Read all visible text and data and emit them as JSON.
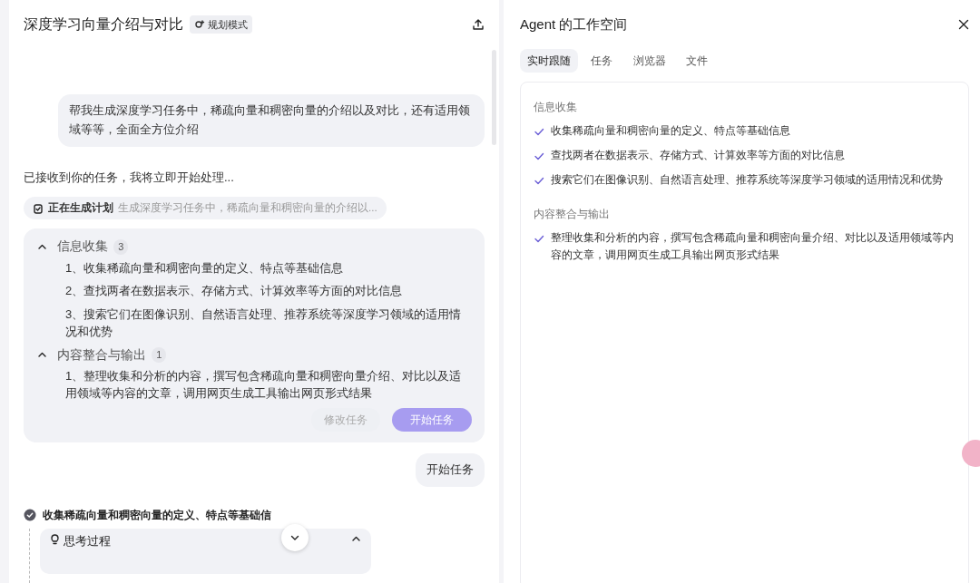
{
  "chat": {
    "title": "深度学习向量介绍与对比",
    "mode_badge": "规划模式",
    "user_message": "帮我生成深度学习任务中，稀疏向量和稠密向量的介绍以及对比，还有适用领域等等，全面全方位介绍",
    "assistant_message": "已接收到你的任务，我将立即开始处理...",
    "plan_status": {
      "label": "正在生成计划",
      "summary": "生成深度学习任务中，稀疏向量和稠密向量的介绍以..."
    },
    "plan_groups": [
      {
        "title": "信息收集",
        "count": "3",
        "expanded": true,
        "items": [
          "1、收集稀疏向量和稠密向量的定义、特点等基础信息",
          "2、查找两者在数据表示、存储方式、计算效率等方面的对比信息",
          "3、搜索它们在图像识别、自然语言处理、推荐系统等深度学习领域的适用情况和优势"
        ]
      },
      {
        "title": "内容整合与输出",
        "count": "1",
        "expanded": true,
        "items": [
          "1、整理收集和分析的内容，撰写包含稀疏向量和稠密向量介绍、对比以及适用领域等内容的文章，调用网页生成工具输出网页形式结果"
        ]
      }
    ],
    "plan_buttons": [
      {
        "label": "修改任务",
        "kind": "secondary"
      },
      {
        "label": "开始任务",
        "kind": "primary"
      }
    ],
    "user_reply": "开始任务",
    "step": {
      "title": "收集稀疏向量和稠密向量的定义、特点等基础信",
      "done": true
    },
    "thinking": {
      "label": "思考过程",
      "expanded": true
    }
  },
  "workspace": {
    "title": "Agent 的工作空间",
    "tabs": [
      {
        "label": "实时跟随",
        "selected": true
      },
      {
        "label": "任务",
        "selected": false
      },
      {
        "label": "浏览器",
        "selected": false
      },
      {
        "label": "文件",
        "selected": false
      }
    ],
    "sections": [
      {
        "title": "信息收集",
        "items": [
          {
            "text": "收集稀疏向量和稠密向量的定义、特点等基础信息",
            "checked": true
          },
          {
            "text": "查找两者在数据表示、存储方式、计算效率等方面的对比信息",
            "checked": true
          },
          {
            "text": "搜索它们在图像识别、自然语言处理、推荐系统等深度学习领域的适用情况和优势",
            "checked": true
          }
        ]
      },
      {
        "title": "内容整合与输出",
        "items": [
          {
            "text": "整理收集和分析的内容，撰写包含稀疏向量和稠密向量介绍、对比以及适用领域等内容的文章，调用网页生成工具输出网页形式结果",
            "checked": true
          }
        ]
      }
    ]
  }
}
